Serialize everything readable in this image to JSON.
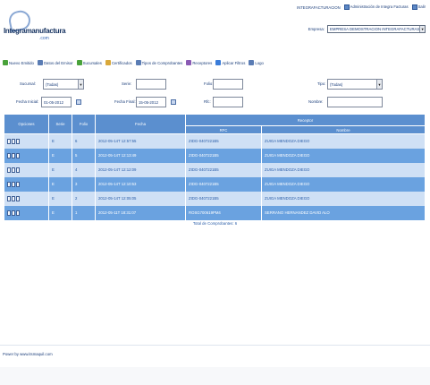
{
  "header": {
    "logo_name": "Integramanufactura",
    "logo_sub": ".com",
    "top_links": [
      "INTEGRAFACTURACION",
      "Administración de Integra Facturas",
      "Salir"
    ],
    "company_label": "Empresa:",
    "company_value": "EMPRESA DEMOSTRACION INTEGRAFACTURAS"
  },
  "nav": {
    "items": [
      {
        "label": "Nuevo Emitido",
        "icon": "new-doc-icon",
        "color": "#49a23a"
      },
      {
        "label": "Datos del Emisor",
        "icon": "issuer-icon",
        "color": "#5a7cb4"
      },
      {
        "label": "Sucursales",
        "icon": "branches-icon",
        "color": "#49a23a"
      },
      {
        "label": "Certificados",
        "icon": "certificate-icon",
        "color": "#d9a83a"
      },
      {
        "label": "Tipos de Comprobantes",
        "icon": "doc-types-icon",
        "color": "#5a7cb4"
      },
      {
        "label": "Receptores",
        "icon": "receivers-icon",
        "color": "#8a5ab4"
      },
      {
        "label": "Aplicar Filtros",
        "icon": "filter-icon",
        "color": "#3a7cd9"
      },
      {
        "label": "Logo",
        "icon": "logo-icon",
        "color": "#5a7cb4"
      }
    ]
  },
  "filters": {
    "sucursal_label": "Sucursal:",
    "sucursal_value": "(Todas)",
    "serie_label": "Serie:",
    "serie_value": "",
    "folio_label": "Folio:",
    "folio_value": "",
    "tipo_label": "Tipo:",
    "tipo_value": "(Todas)",
    "fecha_inicial_label": "Fecha Inicial:",
    "fecha_inicial_value": "01-05-2012",
    "fecha_final_label": "Fecha Final:",
    "fecha_final_value": "15-05-2012",
    "rfc_label": "Rfc:",
    "rfc_value": "",
    "nombre_label": "Nombre:",
    "nombre_value": ""
  },
  "table": {
    "headers": {
      "opciones": "Opciones",
      "serie": "Serie",
      "folio": "Folio",
      "fecha": "Fecha",
      "receptor": "Receptor",
      "rfc": "RFC",
      "nombre": "Nombre"
    },
    "rows": [
      {
        "serie": "E",
        "folio": "6",
        "fecha": "2012-05-14T 12:57:55",
        "rfc": "ZIDG-0407221B5",
        "nombre": "ZUIGA MENDOZA DIEGO"
      },
      {
        "serie": "E",
        "folio": "5",
        "fecha": "2012-05-14T 12:13:49",
        "rfc": "ZIDG-0407221B5",
        "nombre": "ZUIGA MENDOZA DIEGO"
      },
      {
        "serie": "E",
        "folio": "4",
        "fecha": "2012-05-14T 12:12:09",
        "rfc": "ZIDG-0407221B5",
        "nombre": "ZUIGA MENDOZA DIEGO"
      },
      {
        "serie": "E",
        "folio": "3",
        "fecha": "2012-05-14T 12:10:53",
        "rfc": "ZIDG-0407221B5",
        "nombre": "ZUIGA MENDOZA DIEGO"
      },
      {
        "serie": "E",
        "folio": "2",
        "fecha": "2012-05-14T 12:05:05",
        "rfc": "ZIDG-0407221B5",
        "nombre": "ZUIGA MENDOZA DIEGO"
      },
      {
        "serie": "E",
        "folio": "1",
        "fecha": "2012-05-11T 18:31:07",
        "rfc": "ROSG700619PM4",
        "nombre": "SERRANO HERNANDEZ DAVID ALO"
      }
    ],
    "total_label": "Total de Comprobantes: 6"
  },
  "footer": {
    "prefix": "Power by",
    "link": "www.itsmaquil.com"
  },
  "colors": {
    "header_blue": "#5b8fcf",
    "row_light": "#cfe0f5",
    "row_dark": "#6aa2e0"
  }
}
